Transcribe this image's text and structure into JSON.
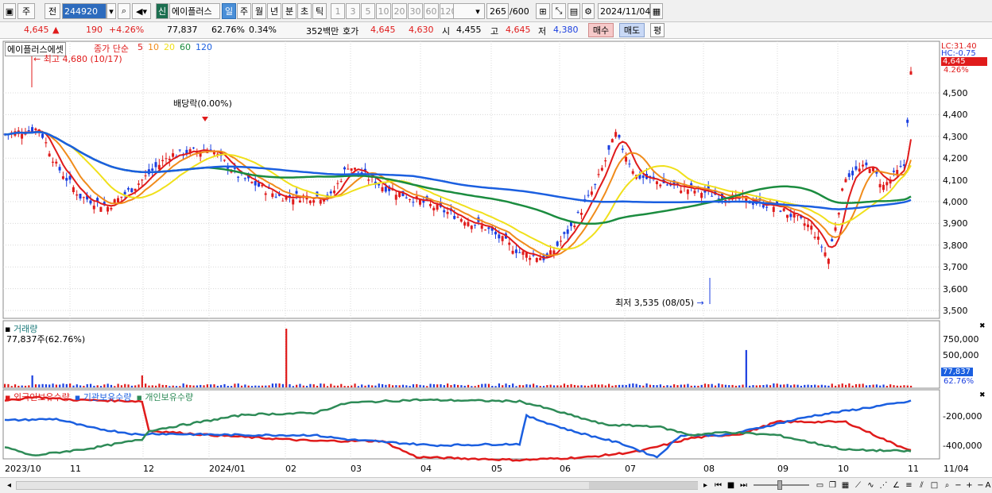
{
  "toolbar": {
    "period_main": "주",
    "prev_label": "전",
    "stock_code": "244920",
    "market_badge": "신",
    "stock_name": "에이플러스",
    "period_tabs": [
      "일",
      "주",
      "월",
      "년",
      "분",
      "초",
      "틱"
    ],
    "active_period": "일",
    "interval_tabs": [
      "1",
      "3",
      "5",
      "10",
      "20",
      "30",
      "60",
      "120"
    ],
    "bar_count": "265",
    "bar_total": "/600",
    "date": "2024/11/04"
  },
  "infobar": {
    "price": "4,645",
    "change_arrow": "▲",
    "change": "190",
    "change_pct": "+4.26%",
    "volume": "77,837",
    "volume_ratio": "62.76%",
    "turnover": "0.34%",
    "amount": "352백만",
    "ask_label": "호가",
    "ask1": "4,645",
    "ask2": "4,630",
    "open_label": "시",
    "open": "4,455",
    "high_label": "고",
    "high": "4,645",
    "low_label": "저",
    "low": "4,380",
    "buy_label": "매수",
    "sell_label": "매도",
    "avg_label": "평"
  },
  "price_panel": {
    "title": "에이플러스에셋",
    "ma_title": "종가 단순",
    "ma_periods": [
      "5",
      "10",
      "20",
      "60",
      "120"
    ],
    "ma_colors": [
      "#e01b1b",
      "#f08c1b",
      "#f0e01b",
      "#1b8c3f",
      "#1b5fe0"
    ],
    "high_annotation": "최고 4,680 (10/17)",
    "low_annotation": "최저 3,535 (08/05)",
    "dividend_annotation": "배당락(0.00%)",
    "lc_label": "LC:31.40",
    "hc_label": "HC:-0.75",
    "current_price_tag": "4,645",
    "current_pct_tag": "4.26%",
    "y_ticks": [
      "4,500",
      "4,400",
      "4,300",
      "4,200",
      "4,100",
      "4,000",
      "3,900",
      "3,800",
      "3,700",
      "3,600",
      "3,500"
    ]
  },
  "volume_panel": {
    "title": "거래량",
    "current": "77,837주(62.76%)",
    "y_ticks": [
      "750,000",
      "500,000"
    ],
    "tag_value": "77,837",
    "tag_pct": "62.76%"
  },
  "holdings_panel": {
    "legend": [
      "외국인보유수량",
      "기관보유수량",
      "개인보유수량"
    ],
    "colors": [
      "#e01b1b",
      "#1b5fe0",
      "#2e8b57"
    ],
    "y_ticks": [
      "-200,000",
      "-400,000"
    ]
  },
  "x_axis": {
    "labels": [
      "2023/10",
      "11",
      "12",
      "2024/01",
      "02",
      "03",
      "04",
      "05",
      "06",
      "07",
      "08",
      "09",
      "10",
      "11"
    ],
    "right_label": "11/04"
  }
}
